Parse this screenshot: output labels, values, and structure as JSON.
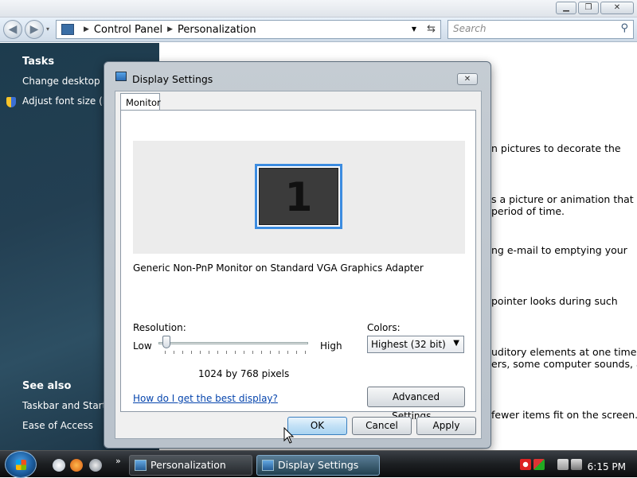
{
  "window": {
    "caption_buttons": {
      "minimize": "▁",
      "maximize": "❐",
      "close": "✕"
    },
    "nav": {
      "back": "◀",
      "forward": "▶",
      "dropdown": "▾"
    },
    "breadcrumb": [
      "Control Panel",
      "Personalization"
    ],
    "search_placeholder": "Search"
  },
  "left_pane": {
    "tasks_heading": "Tasks",
    "tasks": [
      "Change desktop icons",
      "Adjust font size (DPI)"
    ],
    "see_also_heading": "See also",
    "see_also": [
      "Taskbar and Start Menu",
      "Ease of Access"
    ]
  },
  "content_snippets": [
    "n pictures to decorate the",
    "s a picture or animation that",
    "period of time.",
    "ng e-mail to emptying your",
    "pointer looks during such",
    "uditory elements at one time",
    "ers, some computer sounds, and",
    "fewer items fit on the screen."
  ],
  "dialog": {
    "title": "Display Settings",
    "close_glyph": "✕",
    "tab": "Monitor",
    "monitor_number": "1",
    "monitor_description": "Generic Non-PnP Monitor on Standard VGA Graphics Adapter",
    "resolution_label": "Resolution:",
    "low_label": "Low",
    "high_label": "High",
    "resolution_value": "1024 by 768 pixels",
    "resolution_slider_position": 0.05,
    "colors_label": "Colors:",
    "colors_selected": "Highest (32 bit)",
    "help_link": "How do I get the best display?",
    "advanced_button": "Advanced Settings...",
    "ok_button": "OK",
    "cancel_button": "Cancel",
    "apply_button": "Apply"
  },
  "taskbar": {
    "chevron": "»",
    "buttons": [
      {
        "label": "Personalization",
        "active": false
      },
      {
        "label": "Display Settings",
        "active": true
      }
    ],
    "clock": "6:15 PM"
  },
  "colors": {
    "accent_selection": "#3c8ce0",
    "left_pane_bg": "#233f52",
    "link": "#0645ad",
    "taskbar_bg": "#1c1f22"
  }
}
